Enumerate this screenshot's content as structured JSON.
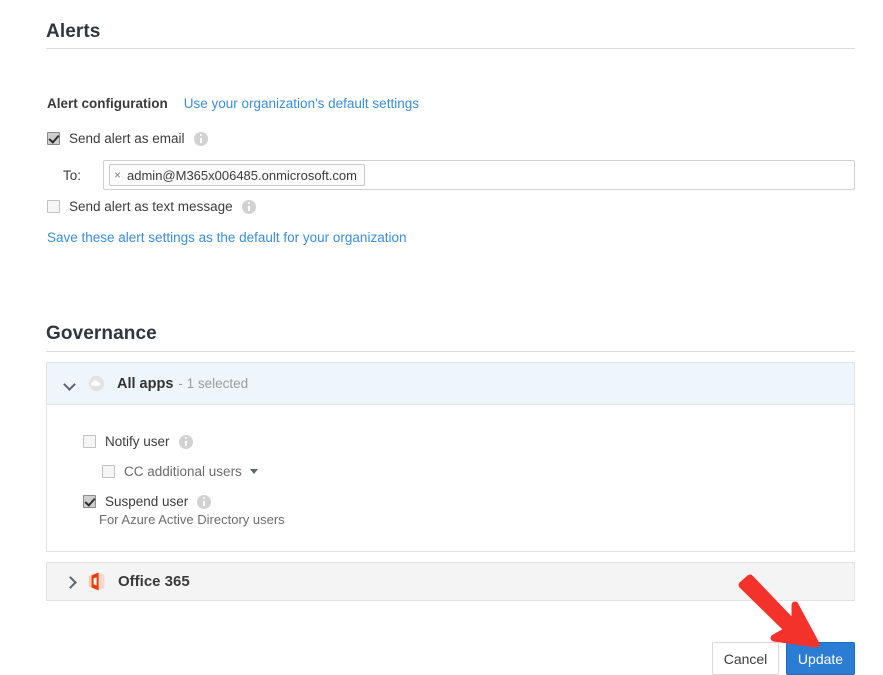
{
  "alerts": {
    "title": "Alerts",
    "config_label": "Alert configuration",
    "config_link": "Use your organization's default settings",
    "email_checkbox_label": "Send alert as email",
    "to_label": "To:",
    "recipient_token": "admin@M365x006485.onmicrosoft.com",
    "token_remove": "×",
    "text_checkbox_label": "Send alert as text message",
    "save_default_link": "Save these alert settings as the default for your organization"
  },
  "governance": {
    "title": "Governance",
    "all_apps": {
      "title": "All apps",
      "subtitle": "- 1 selected",
      "notify_user_label": "Notify user",
      "cc_users_label": "CC additional users",
      "suspend_user_label": "Suspend user",
      "suspend_user_note": "For Azure Active Directory users"
    },
    "office365": {
      "title": "Office 365"
    }
  },
  "footer": {
    "cancel_label": "Cancel",
    "update_label": "Update"
  },
  "colors": {
    "primary_button": "#2b7cd3",
    "link": "#3a8ddd",
    "panel_header": "#eef6fc",
    "annotation_arrow": "#f3322c",
    "office_icon": "#eb3c00"
  }
}
